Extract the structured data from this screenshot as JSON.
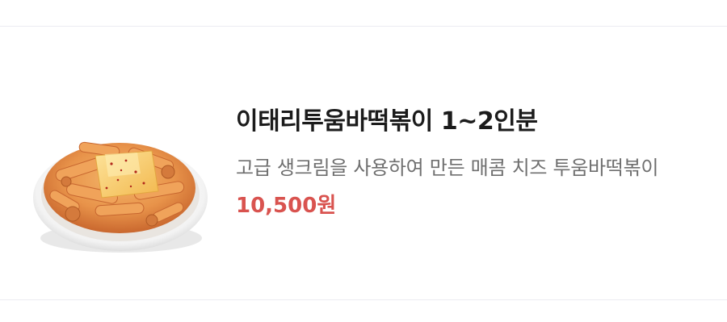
{
  "menu_item": {
    "title": "이태리투움바떡볶이 1~2인분",
    "description": "고급 생크림을 사용하여 만든 매콤 치즈 투움바떡볶이",
    "price": "10,500원",
    "image": "tteokbokki-dish-photo"
  },
  "colors": {
    "title": "#1b1b1b",
    "description": "#6f6f6f",
    "price": "#d9534f",
    "divider": "#ececf2"
  }
}
